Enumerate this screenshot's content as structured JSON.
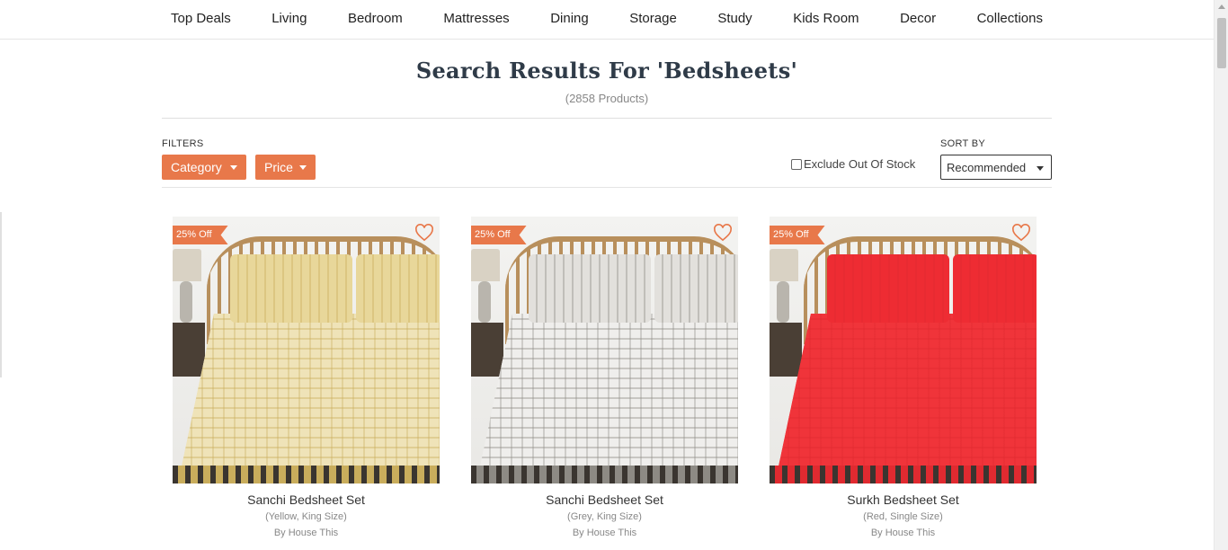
{
  "nav": {
    "items": [
      "Top Deals",
      "Living",
      "Bedroom",
      "Mattresses",
      "Dining",
      "Storage",
      "Study",
      "Kids Room",
      "Decor",
      "Collections"
    ]
  },
  "search": {
    "title": "Search Results For 'Bedsheets'",
    "count": "(2858 Products)"
  },
  "filters": {
    "label": "FILTERS",
    "category": "Category",
    "price": "Price",
    "exclude_label": "Exclude Out Of Stock",
    "exclude_checked": false
  },
  "sort": {
    "label": "SORT BY",
    "selected": "Recommended"
  },
  "products": [
    {
      "badge": "25% Off",
      "name": "Sanchi Bedsheet Set",
      "variant": "(Yellow, King Size)",
      "brand": "By House This",
      "colors": {
        "sheet": "#efe3b8",
        "pattern": "#c9ad5c",
        "pillow": "#e8d79a"
      }
    },
    {
      "badge": "25% Off",
      "name": "Sanchi Bedsheet Set",
      "variant": "(Grey, King Size)",
      "brand": "By House This",
      "colors": {
        "sheet": "#efeeec",
        "pattern": "#8d8a84",
        "pillow": "#e2e0dc"
      }
    },
    {
      "badge": "25% Off",
      "name": "Surkh Bedsheet Set",
      "variant": "(Red, Single Size)",
      "brand": "By House This",
      "colors": {
        "sheet": "#f0343a",
        "pattern": "#e02a30",
        "pillow": "#ee2c33"
      }
    }
  ],
  "theme": {
    "accent": "#e8784a"
  }
}
